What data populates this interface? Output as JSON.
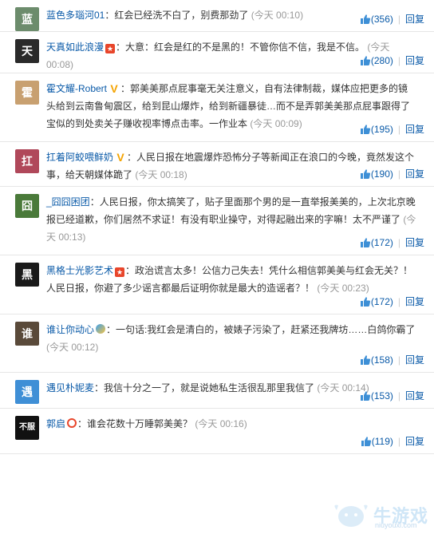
{
  "comments": [
    {
      "user": "蓝色多瑙河01",
      "badge": "",
      "text": "：红会已经洗不白了，别费那劲了",
      "time": "(今天 00:10)",
      "likes": "(356)",
      "reply": "回复",
      "avatar_color": "#6c8c6c",
      "avatar_glyph": "蓝"
    },
    {
      "user": "天真如此浪漫",
      "badge": "star",
      "text": "：大意：红会是红的不是黑的！不管你信不信，我是不信。",
      "time": "(今天 00:08)",
      "likes": "(280)",
      "reply": "回复",
      "avatar_color": "#2a2a2a",
      "avatar_glyph": "天"
    },
    {
      "user": "霍文耀-Robert",
      "badge": "v",
      "text": "：郭美美那点屁事毫无关注意义，自有法律制裁，媒体应把更多的镜头给到云南鲁甸震区，给到昆山爆炸，给到新疆暴徒…而不是弄郭美美那点屁事跟得了宝似的到处卖关子赚收视率博点击率。一作业本",
      "time": "(今天 00:09)",
      "likes": "(195)",
      "reply": "回复",
      "avatar_color": "#c8a070",
      "avatar_glyph": "霍"
    },
    {
      "user": "扛着阿蛟喂鲜奶",
      "badge": "v",
      "text": "：人民日报在地震爆炸恐怖分子等新闻正在浪口的今晚，竟然发这个事，给天朝媒体跪了",
      "time": "(今天 00:18)",
      "likes": "(190)",
      "reply": "回复",
      "avatar_color": "#b0485a",
      "avatar_glyph": "扛"
    },
    {
      "user": "_囧囧困团",
      "badge": "",
      "text": "：人民日报，你太搞笑了，贴子里面那个男的是一直举报美美的，上次北京晚报已经道歉，你们居然不求证！有没有职业操守，对得起融出来的字嘛！太不严谨了",
      "time": "(今天 00:13)",
      "likes": "(172)",
      "reply": "回复",
      "avatar_color": "#4a7a3a",
      "avatar_glyph": "囧"
    },
    {
      "user": "黑格士光影艺术",
      "badge": "star",
      "text": "：政治谎言太多！公信力己失去！凭什么相信郭美美与红会无关？！人民日报，你避了多少谣言都最后证明你就是最大的造谣者？！",
      "time": "(今天 00:23)",
      "likes": "(172)",
      "reply": "回复",
      "avatar_color": "#1a1a1a",
      "avatar_glyph": "黑"
    },
    {
      "user": "谁让你动心",
      "badge": "bulb",
      "text": "：一句话:我红会是清白的，被婊子污染了，赶紧还我牌坊……白鸽你霸了",
      "time": "(今天 00:12)",
      "likes": "(158)",
      "reply": "回复",
      "avatar_color": "#5a4a3a",
      "avatar_glyph": "谁"
    },
    {
      "user": "遇见朴妮麦",
      "badge": "",
      "text": "：我信十分之一了，就是说她私生活很乱那里我信了",
      "time": "(今天 00:14)",
      "likes": "(153)",
      "reply": "回复",
      "avatar_color": "#3f8fd6",
      "avatar_glyph": "遇"
    },
    {
      "user": "郭启",
      "badge": "ring",
      "text": "：谁会花数十万睡郭美美？",
      "time": "(今天 00:16)",
      "likes": "(119)",
      "reply": "回复",
      "avatar_color": "#111111",
      "avatar_glyph": "不服"
    }
  ],
  "watermark": {
    "text": "牛游戏",
    "sub": "niuyouxi.com"
  }
}
